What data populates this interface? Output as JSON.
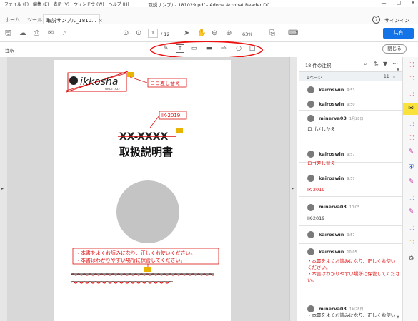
{
  "titlebar": {
    "menu": [
      "ファイル (F)",
      "編集 (E)",
      "表示 (V)",
      "ウィンドウ (W)",
      "ヘルプ (H)"
    ],
    "title": "取説サンプル_181029.pdf - Adobe Acrobat Reader DC",
    "controls": [
      "—",
      "□",
      "✕"
    ]
  },
  "tabs": {
    "home": "ホーム",
    "tools": "ツール",
    "doc": "取説サンプル_1810...",
    "doc_close": "×",
    "help": "?",
    "signin": "サインイン"
  },
  "toolbar": {
    "page_current": "1",
    "page_total": "/ 12",
    "zoom": "63%",
    "share": "共有"
  },
  "comment_bar": {
    "label": "注釈",
    "close": "閉じる"
  },
  "document": {
    "logo_text": "ikkosha",
    "logo_sub": "SINCE 1922",
    "note_logo": "ロゴ差し替え",
    "note_code": "IK-2019",
    "code_struck": "XX-XXXX",
    "doc_title": "取扱説明書",
    "insert_lines": [
      "・本書をよくお読みになり、正しくお使いください。",
      "・本書はわかりやすい場所に保管してください。"
    ]
  },
  "panel": {
    "header": "18 件の注釈",
    "page_label": "1ページ",
    "page_count": "11",
    "comments": [
      {
        "user": "kairoswin",
        "time": "9:53",
        "body": "",
        "color": "#333333"
      },
      {
        "user": "kairoswin",
        "time": "9:50",
        "body": "",
        "color": "#333333"
      },
      {
        "user": "minerva03",
        "time": "1月28日",
        "body": "ロゴさしかえ",
        "color": "#333333"
      },
      {
        "user": "kairoswin",
        "time": "9:57",
        "body": "ロゴ差し替え",
        "color": "#dd1111"
      },
      {
        "user": "kairoswin",
        "time": "9:57",
        "body": "IK-2019",
        "color": "#dd1111"
      },
      {
        "user": "minerva03",
        "time": "10:05",
        "body": "IK-2019",
        "color": "#333333"
      },
      {
        "user": "kairoswin",
        "time": "9:57",
        "body": "",
        "color": "#333333"
      },
      {
        "user": "kairoswin",
        "time": "10:05",
        "body": "・本書をよくお読みになり、正しくお使い\nください。\n・本書はわかりやすい場所に保管してくださ\nい。",
        "color": "#dd1111"
      },
      {
        "user": "minerva03",
        "time": "1月28日",
        "body": "・本書をよくお読みになり、正しくお使い",
        "color": "#333333"
      }
    ]
  },
  "colors": {
    "accent": "#1473e6",
    "markup_red": "#dd1111",
    "active_tool": "#f9e23a"
  }
}
